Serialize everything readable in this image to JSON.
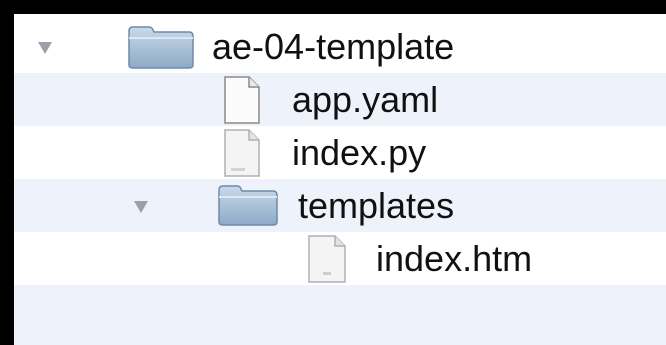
{
  "tree": {
    "items": [
      {
        "label": "ae-04-template",
        "kind": "folder",
        "expanded": true,
        "icon": "folder-icon"
      },
      {
        "label": "app.yaml",
        "kind": "file",
        "icon": "document-icon"
      },
      {
        "label": "index.py",
        "kind": "file",
        "icon": "python-file-icon"
      },
      {
        "label": "templates",
        "kind": "folder",
        "expanded": true,
        "icon": "folder-icon"
      },
      {
        "label": "index.htm",
        "kind": "file",
        "icon": "html-file-icon"
      }
    ]
  },
  "colors": {
    "background": "#000000",
    "row_even": "#ffffff",
    "row_odd": "#eef3fb",
    "folder_blue": "#a9c1d9",
    "disclosure": "#9aa0a8"
  }
}
